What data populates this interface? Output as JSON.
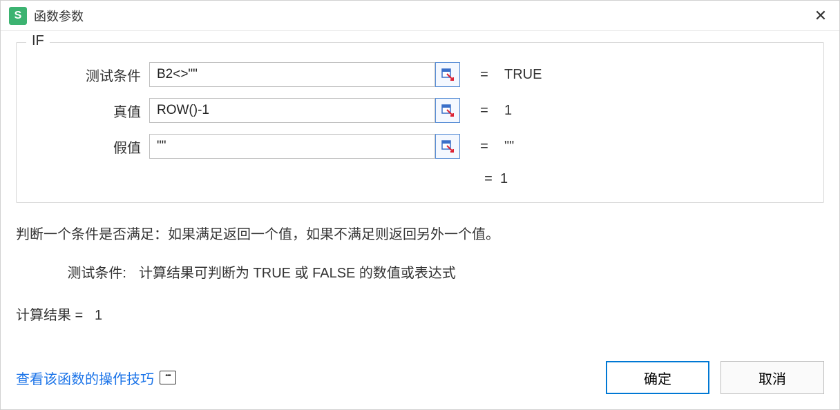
{
  "app": {
    "icon_letter": "S",
    "title": "函数参数"
  },
  "function_name": "IF",
  "params": [
    {
      "label": "测试条件",
      "value": "B2<>\"\"",
      "result": "TRUE"
    },
    {
      "label": "真值",
      "value": "ROW()-1",
      "result": "1"
    },
    {
      "label": "假值",
      "value": "\"\"",
      "result": "\"\""
    }
  ],
  "overall_result": "1",
  "description": "判断一个条件是否满足：如果满足返回一个值，如果不满足则返回另外一个值。",
  "arg_help": {
    "label": "测试条件:",
    "text": "计算结果可判断为 TRUE 或 FALSE 的数值或表达式"
  },
  "calc_result_label": "计算结果 =",
  "calc_result_value": "1",
  "help_link": "查看该函数的操作技巧",
  "buttons": {
    "ok": "确定",
    "cancel": "取消"
  },
  "equals": "="
}
